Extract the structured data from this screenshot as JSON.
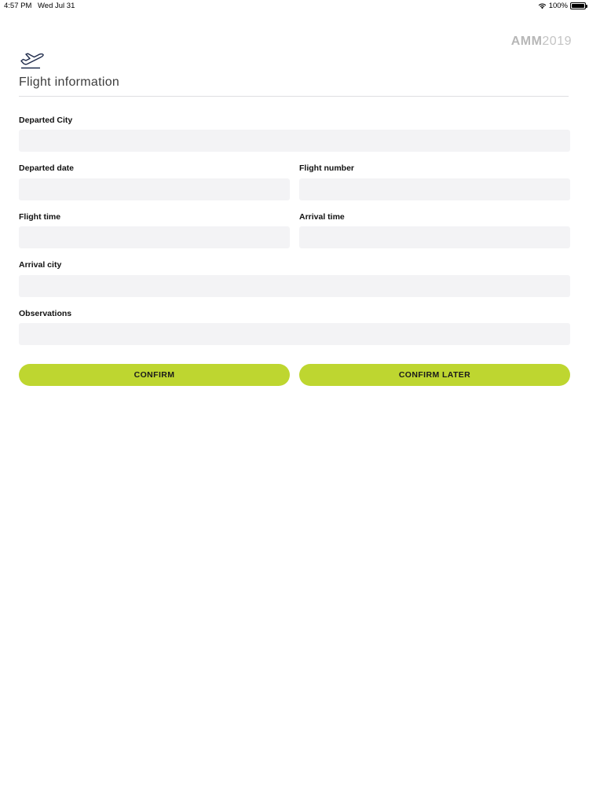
{
  "status_bar": {
    "time": "4:57 PM",
    "date": "Wed Jul 31",
    "battery": "100%"
  },
  "brand": {
    "bold": "AMM",
    "light": "2019",
    "color": "#b7b7b7"
  },
  "header": {
    "icon": "airplane-takeoff-icon",
    "title": "Flight information"
  },
  "form": {
    "departed_city": {
      "label": "Departed City",
      "value": "",
      "placeholder": ""
    },
    "departed_date": {
      "label": "Departed date",
      "value": "",
      "placeholder": ""
    },
    "flight_number": {
      "label": "Flight number",
      "value": "",
      "placeholder": ""
    },
    "flight_time": {
      "label": "Flight time",
      "value": "",
      "placeholder": ""
    },
    "arrival_time": {
      "label": "Arrival time",
      "value": "",
      "placeholder": ""
    },
    "arrival_city": {
      "label": "Arrival city",
      "value": "",
      "placeholder": ""
    },
    "observations": {
      "label": "Observations",
      "value": "",
      "placeholder": ""
    }
  },
  "actions": {
    "confirm": "CONFIRM",
    "confirm_later": "CONFIRM LATER"
  },
  "colors": {
    "accent": "#bed630",
    "input_background": "#f3f3f5"
  }
}
